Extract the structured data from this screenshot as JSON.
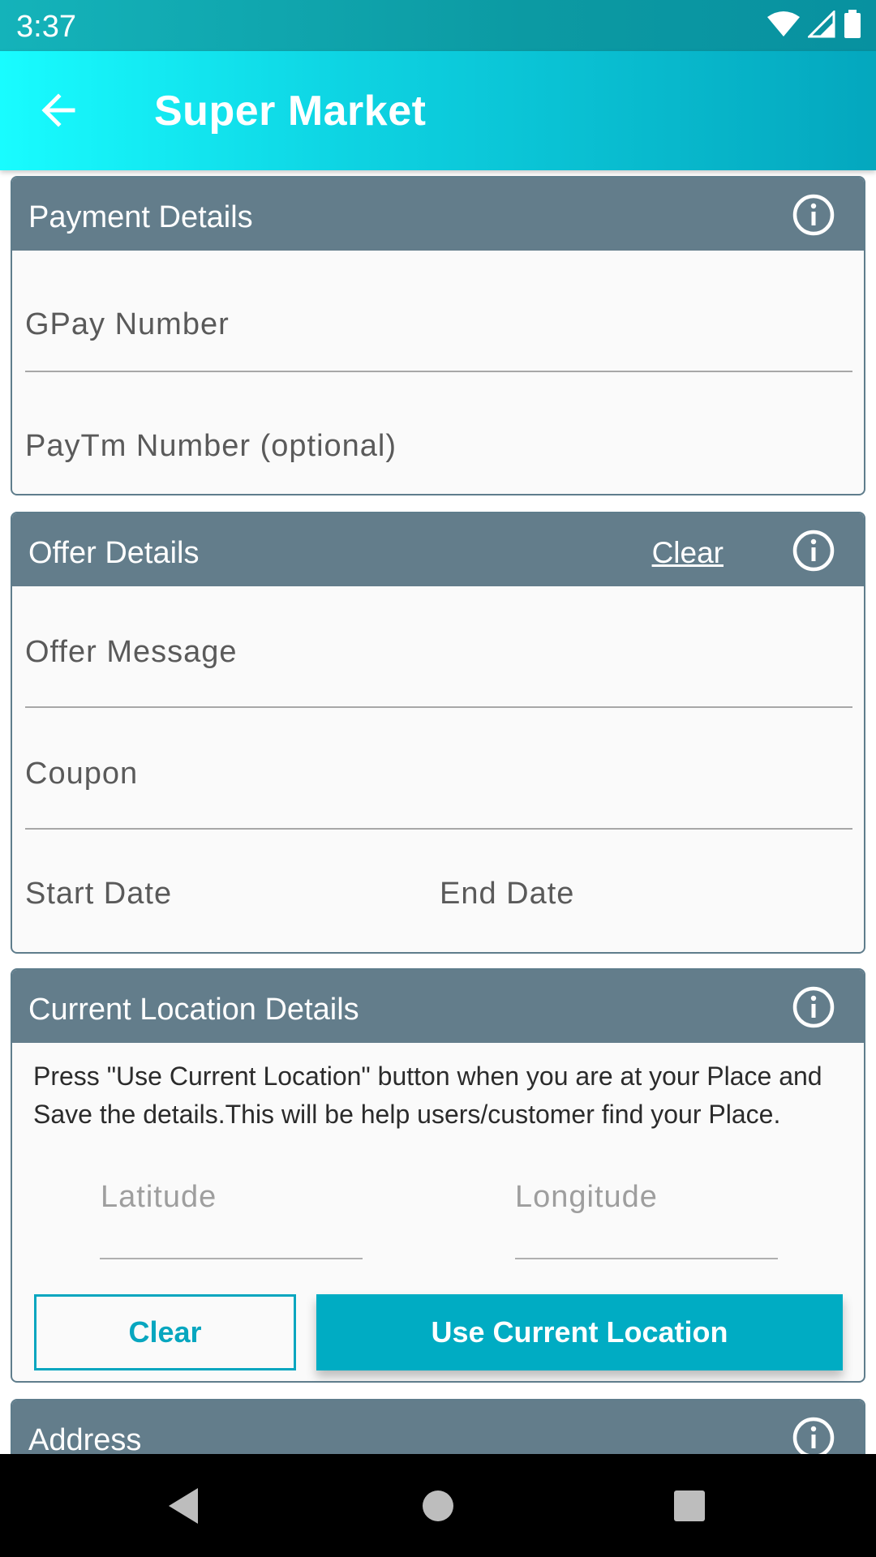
{
  "status_bar": {
    "time": "3:37"
  },
  "app_bar": {
    "title": "Super Market",
    "back_icon": "arrow-back-icon"
  },
  "payment": {
    "title": "Payment Details",
    "fields": {
      "gpay": "GPay Number",
      "paytm": "PayTm Number (optional)"
    }
  },
  "offer": {
    "title": "Offer Details",
    "clear_link": "Clear",
    "fields": {
      "message": "Offer Message",
      "coupon": "Coupon",
      "start_date": "Start Date",
      "end_date": "End Date"
    }
  },
  "location": {
    "title": "Current Location Details",
    "note": "Press \"Use Current Location\" button when you are at your Place and Save the details.This will be help users/customer find your Place.",
    "latitude": "Latitude",
    "longitude": "Longitude",
    "clear_button": "Clear",
    "use_location_button": "Use Current Location"
  },
  "address": {
    "title": "Address"
  },
  "colors": {
    "header": "#637d8b",
    "accent": "#00acc3",
    "appbar_start": "#18fcff",
    "appbar_end": "#04a7be"
  }
}
